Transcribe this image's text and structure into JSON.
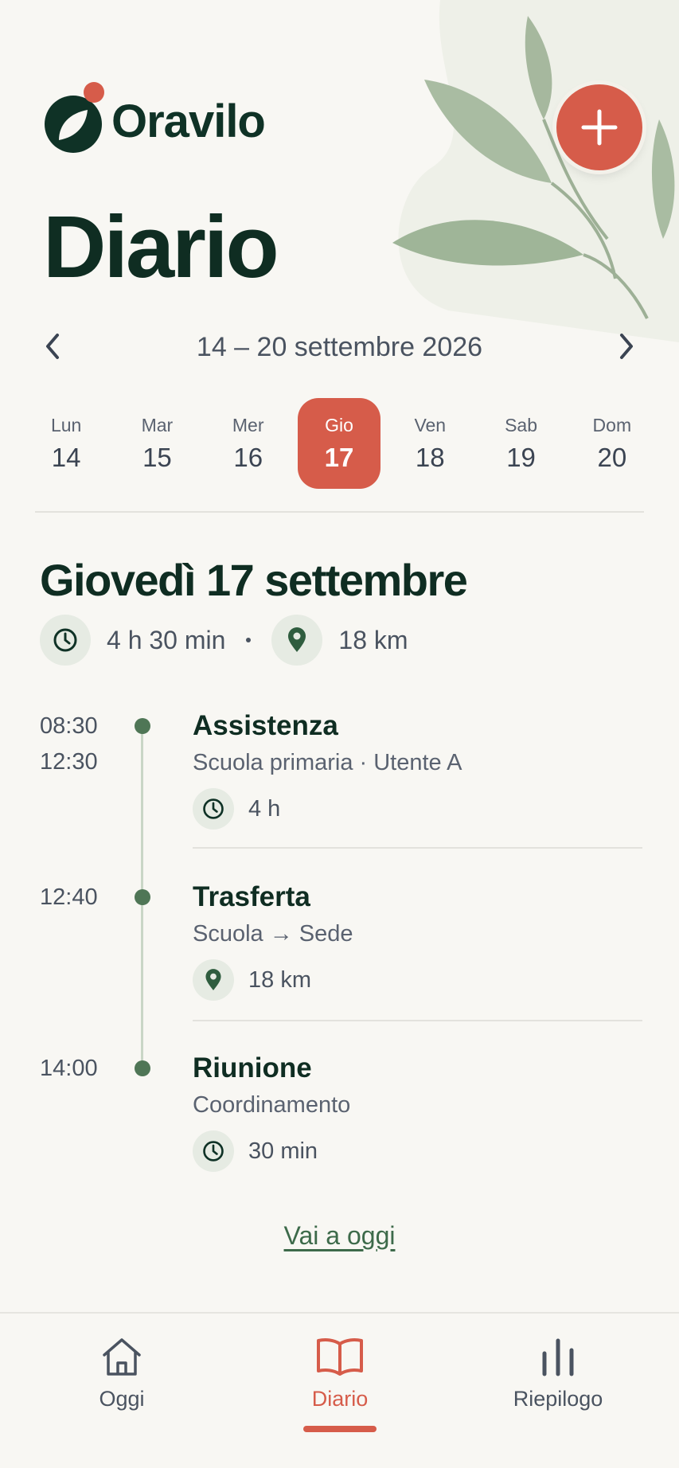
{
  "app": {
    "name": "Oravilo",
    "page_title": "Diario"
  },
  "colors": {
    "accent": "#d65c4a",
    "primary": "#0f2d22",
    "green": "#4f7656",
    "background": "#f8f7f3"
  },
  "week": {
    "range_label": "14 – 20 settembre 2026",
    "prev_icon": "chevron-left-icon",
    "next_icon": "chevron-right-icon",
    "days": [
      {
        "name": "Lun",
        "num": "14"
      },
      {
        "name": "Mar",
        "num": "15"
      },
      {
        "name": "Mer",
        "num": "16"
      },
      {
        "name": "Gio",
        "num": "17",
        "selected": true
      },
      {
        "name": "Ven",
        "num": "18"
      },
      {
        "name": "Sab",
        "num": "19"
      },
      {
        "name": "Dom",
        "num": "20"
      }
    ]
  },
  "day": {
    "heading": "Giovedì 17 settembre",
    "total_time": "4 h 30 min",
    "total_distance": "18 km"
  },
  "entries": [
    {
      "start": "08:30",
      "end": "12:30",
      "title": "Assistenza",
      "subtitle": "Scuola primaria · Utente A",
      "meta_icon": "clock-icon",
      "meta": "4 h"
    },
    {
      "start": "12:40",
      "end": "",
      "title": "Trasferta",
      "subtitle": "Scuola → Sede",
      "meta_icon": "location-pin-icon",
      "meta": "18 km"
    },
    {
      "start": "14:00",
      "end": "",
      "title": "Riunione",
      "subtitle": "Coordinamento",
      "meta_icon": "clock-icon",
      "meta": "30 min"
    }
  ],
  "today_link": "Vai a oggi",
  "nav": {
    "items": [
      {
        "label": "Oggi",
        "icon": "home-icon"
      },
      {
        "label": "Diario",
        "icon": "book-icon",
        "active": true
      },
      {
        "label": "Riepilogo",
        "icon": "bar-chart-icon"
      }
    ]
  }
}
